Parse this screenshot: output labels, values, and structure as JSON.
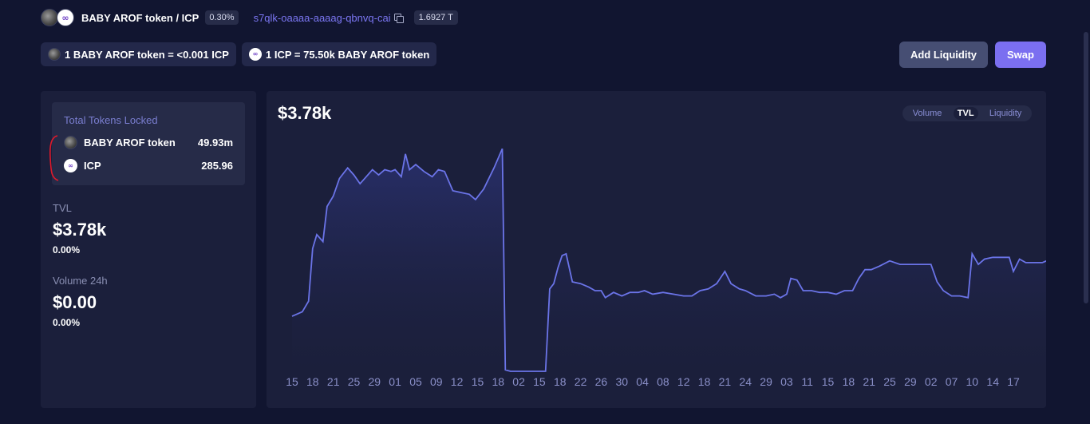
{
  "header": {
    "pair_title": "BABY AROF token / ICP",
    "fee": "0.30%",
    "canister_id": "s7qlk-oaaaa-aaaag-qbnvq-cai",
    "cycles": "1.6927 T"
  },
  "rates": {
    "rate1": "1 BABY AROF token = <0.001 ICP",
    "rate2": "1 ICP = 75.50k BABY AROF token"
  },
  "buttons": {
    "add_liquidity": "Add Liquidity",
    "swap": "Swap"
  },
  "locked": {
    "title": "Total Tokens Locked",
    "rows": [
      {
        "name": "BABY AROF token",
        "amount": "49.93m",
        "icon": "baby-arof-token-icon"
      },
      {
        "name": "ICP",
        "amount": "285.96",
        "icon": "icp-icon"
      }
    ]
  },
  "stats": {
    "tvl_label": "TVL",
    "tvl_value": "$3.78k",
    "tvl_change": "0.00%",
    "volume_label": "Volume 24h",
    "volume_value": "$0.00",
    "volume_change": "0.00%"
  },
  "chart_header": {
    "value": "$3.78k",
    "tabs": [
      "Volume",
      "TVL",
      "Liquidity"
    ],
    "active_tab": "TVL"
  },
  "colors": {
    "accent": "#7b6ff0",
    "line": "#6b74e8",
    "background": "#111530",
    "panel": "#1b1f3b",
    "annotation": "#e0192b"
  },
  "chart_data": {
    "type": "area",
    "title": "",
    "xlabel": "",
    "ylabel": "",
    "x_ticks": [
      "15",
      "18",
      "21",
      "25",
      "29",
      "01",
      "05",
      "09",
      "12",
      "15",
      "18",
      "02",
      "15",
      "18",
      "22",
      "26",
      "30",
      "04",
      "08",
      "12",
      "18",
      "21",
      "24",
      "29",
      "03",
      "11",
      "15",
      "18",
      "21",
      "25",
      "29",
      "02",
      "07",
      "10",
      "14",
      "17"
    ],
    "ylim": [
      0,
      6.4
    ],
    "grid": false,
    "legend": "none",
    "series": [
      {
        "values": [
          [
            0,
            1.57
          ],
          [
            0.5,
            1.7
          ],
          [
            0.8,
            2.0
          ],
          [
            1.0,
            3.5
          ],
          [
            1.2,
            3.9
          ],
          [
            1.5,
            3.7
          ],
          [
            1.7,
            4.7
          ],
          [
            2.0,
            5.0
          ],
          [
            2.3,
            5.5
          ],
          [
            2.7,
            5.8
          ],
          [
            3.0,
            5.6
          ],
          [
            3.3,
            5.35
          ],
          [
            3.6,
            5.55
          ],
          [
            3.9,
            5.75
          ],
          [
            4.2,
            5.6
          ],
          [
            4.5,
            5.75
          ],
          [
            4.8,
            5.7
          ],
          [
            5.0,
            5.75
          ],
          [
            5.3,
            5.55
          ],
          [
            5.5,
            6.2
          ],
          [
            5.7,
            5.75
          ],
          [
            6.0,
            5.9
          ],
          [
            6.4,
            5.7
          ],
          [
            6.8,
            5.55
          ],
          [
            7.1,
            5.75
          ],
          [
            7.4,
            5.7
          ],
          [
            7.8,
            5.15
          ],
          [
            8.2,
            5.1
          ],
          [
            8.6,
            5.05
          ],
          [
            8.9,
            4.9
          ],
          [
            9.3,
            5.2
          ],
          [
            9.8,
            5.8
          ],
          [
            10.2,
            6.35
          ],
          [
            10.35,
            0.04
          ],
          [
            10.6,
            0.0
          ],
          [
            12.3,
            0.0
          ],
          [
            12.5,
            2.35
          ],
          [
            12.7,
            2.5
          ],
          [
            12.9,
            2.95
          ],
          [
            13.1,
            3.3
          ],
          [
            13.3,
            3.35
          ],
          [
            13.6,
            2.55
          ],
          [
            14.0,
            2.5
          ],
          [
            14.4,
            2.4
          ],
          [
            14.7,
            2.3
          ],
          [
            15.0,
            2.3
          ],
          [
            15.2,
            2.1
          ],
          [
            15.6,
            2.25
          ],
          [
            16.0,
            2.15
          ],
          [
            16.4,
            2.25
          ],
          [
            16.8,
            2.25
          ],
          [
            17.1,
            2.3
          ],
          [
            17.5,
            2.2
          ],
          [
            18.0,
            2.25
          ],
          [
            18.5,
            2.2
          ],
          [
            19.0,
            2.15
          ],
          [
            19.4,
            2.15
          ],
          [
            19.8,
            2.3
          ],
          [
            20.2,
            2.35
          ],
          [
            20.6,
            2.5
          ],
          [
            21.0,
            2.85
          ],
          [
            21.3,
            2.5
          ],
          [
            21.7,
            2.35
          ],
          [
            22.0,
            2.3
          ],
          [
            22.5,
            2.15
          ],
          [
            23.0,
            2.15
          ],
          [
            23.4,
            2.2
          ],
          [
            23.7,
            2.1
          ],
          [
            24.0,
            2.2
          ],
          [
            24.2,
            2.65
          ],
          [
            24.5,
            2.6
          ],
          [
            24.8,
            2.3
          ],
          [
            25.2,
            2.3
          ],
          [
            25.6,
            2.25
          ],
          [
            26.0,
            2.25
          ],
          [
            26.4,
            2.2
          ],
          [
            26.8,
            2.3
          ],
          [
            27.2,
            2.3
          ],
          [
            27.5,
            2.65
          ],
          [
            27.8,
            2.9
          ],
          [
            28.1,
            2.9
          ],
          [
            28.5,
            3.0
          ],
          [
            29.0,
            3.15
          ],
          [
            29.5,
            3.05
          ],
          [
            30.0,
            3.05
          ],
          [
            30.5,
            3.05
          ],
          [
            31.0,
            3.05
          ],
          [
            31.3,
            2.55
          ],
          [
            31.6,
            2.3
          ],
          [
            32.0,
            2.15
          ],
          [
            32.4,
            2.15
          ],
          [
            32.8,
            2.1
          ],
          [
            33.0,
            3.35
          ],
          [
            33.3,
            3.05
          ],
          [
            33.6,
            3.2
          ],
          [
            34.0,
            3.25
          ],
          [
            34.5,
            3.25
          ],
          [
            34.8,
            3.25
          ],
          [
            35.0,
            2.85
          ],
          [
            35.3,
            3.2
          ],
          [
            35.6,
            3.1
          ],
          [
            36.0,
            3.1
          ],
          [
            36.4,
            3.1
          ],
          [
            36.8,
            3.2
          ]
        ]
      }
    ]
  }
}
